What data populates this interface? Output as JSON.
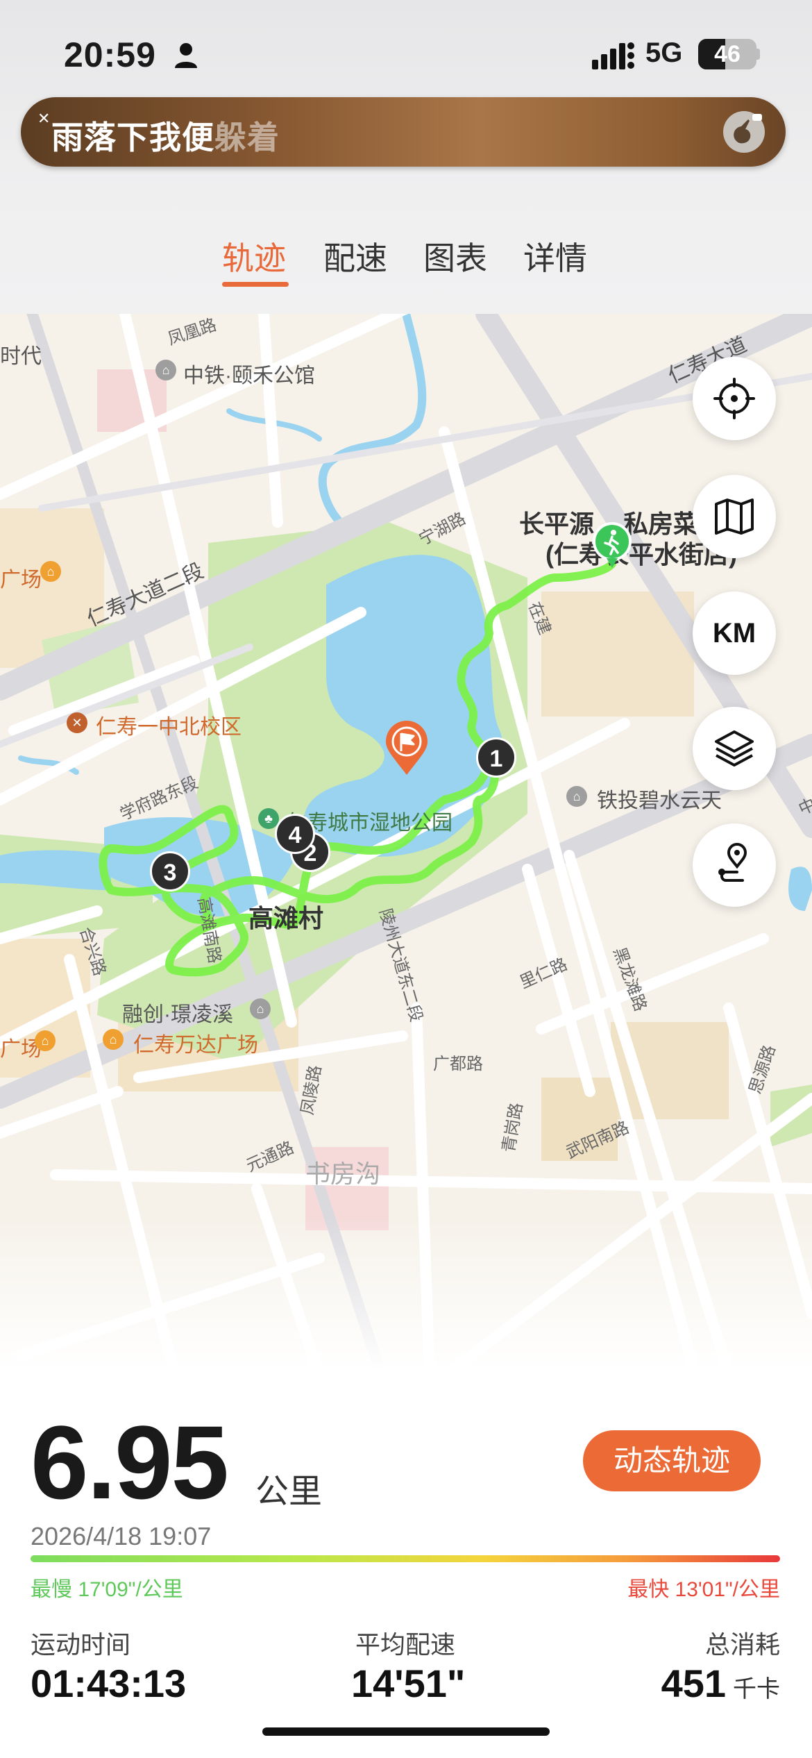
{
  "status_bar": {
    "time": "20:59",
    "network": "5G",
    "battery": "46",
    "battery_level": 0.46
  },
  "music": {
    "lyric_sung": "雨落下我便",
    "lyric_rest": "躲着"
  },
  "tabs": [
    {
      "label": "轨迹",
      "active": true
    },
    {
      "label": "配速",
      "active": false
    },
    {
      "label": "图表",
      "active": false
    },
    {
      "label": "详情",
      "active": false
    }
  ],
  "map": {
    "labels": {
      "fenghuang_rd": "凤凰路",
      "shidai": "时代",
      "zhongtie": "中铁·颐禾公馆",
      "renshou_ave": "仁寿大道",
      "renshou_ave_2": "仁寿大道二段",
      "ninghu_rd": "宁湖路",
      "changping_1": "长平源",
      "changping_2": "私房菜",
      "changping_3": "(仁寿长平水街店)",
      "zai_jian": "在建",
      "guang_left": "广场",
      "school": "仁寿一中北校区",
      "xuefu_rd": "学府路东段",
      "park": "仁寿城市湿地公园",
      "tietou": "铁投碧水云天",
      "gaotan": "高滩村",
      "gaotan_s_rd": "高滩南路",
      "lingzhou_ave": "陵州大道东二段",
      "hexing_rd": "合兴路",
      "liren_rd": "里仁路",
      "heilongtan_rd": "黑龙滩路",
      "rongchuang": "融创·璟凌溪",
      "wanda": "仁寿万达广场",
      "guang_left2": "广场",
      "guangdu_rd": "广都路",
      "fengling_rd": "凤陵路",
      "yuantong_rd": "元通路",
      "qinggang_rd": "青岗路",
      "wuyang_s_rd": "武阳南路",
      "siyuan_rd": "思源路",
      "shufanggou": "书房沟",
      "zhong": "中"
    },
    "km_button": "KM",
    "markers": [
      "1",
      "2",
      "3",
      "4"
    ]
  },
  "stats": {
    "distance": "6.95",
    "distance_unit": "公里",
    "dynamic_track_button": "动态轨迹",
    "date": "2026/4/18 19:07",
    "slowest": "最慢 17'09\"/公里",
    "fastest": "最快 13'01\"/公里",
    "duration_label": "运动时间",
    "duration": "01:43:13",
    "pace_label": "平均配速",
    "pace": "14'51\"",
    "calories_label": "总消耗",
    "calories": "451",
    "calories_unit": "千卡"
  },
  "colors": {
    "accent": "#ec6a35",
    "track": "#7cf04a",
    "water": "#9ad3f0",
    "park": "#cfe8b2"
  }
}
